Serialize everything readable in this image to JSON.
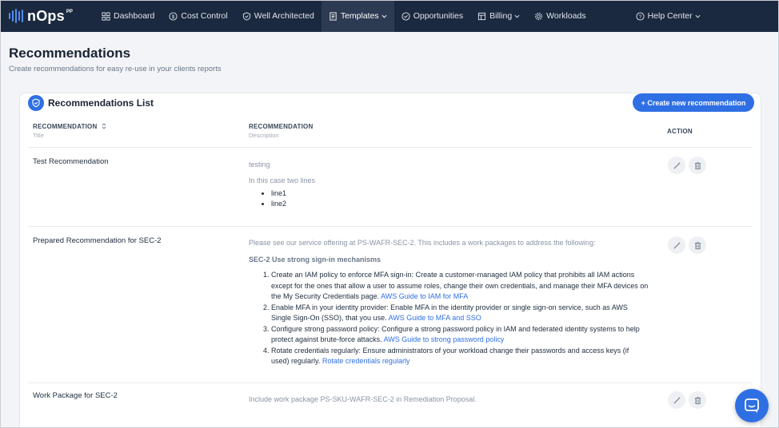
{
  "nav": {
    "logo_text": "nOps",
    "logo_sup": "PP",
    "items": [
      {
        "label": "Dashboard",
        "icon": "grid-icon"
      },
      {
        "label": "Cost Control",
        "icon": "dollar-circle-icon"
      },
      {
        "label": "Well Architected",
        "icon": "shield-check-icon"
      },
      {
        "label": "Templates",
        "icon": "document-icon",
        "active": true,
        "dropdown": true
      },
      {
        "label": "Opportunities",
        "icon": "check-circle-icon"
      },
      {
        "label": "Billing",
        "icon": "billing-icon",
        "dropdown": true
      },
      {
        "label": "Workloads",
        "icon": "gear-icon"
      }
    ],
    "help": {
      "label": "Help Center",
      "icon": "help-circle-icon"
    }
  },
  "page": {
    "title": "Recommendations",
    "subtitle": "Create recommendations for easy re-use in your clients reports"
  },
  "card": {
    "title": "Recommendations List",
    "create_button": "+ Create new recommendation"
  },
  "table": {
    "columns": [
      {
        "label": "RECOMMENDATION",
        "sub": "Title"
      },
      {
        "label": "RECOMMENDATION",
        "sub": "Description"
      },
      {
        "label": "ACTION",
        "sub": ""
      }
    ],
    "rows": [
      {
        "title": "Test Recommendation",
        "desc_line1": "testing",
        "desc_line2": "In this case two lines",
        "bullets": [
          "line1",
          "line2"
        ]
      },
      {
        "title": "Prepared Recommendation for SEC-2",
        "intro": "Please see our service offering at PS-WAFR-SEC-2. This includes a work packages to address the following:",
        "subhead": "SEC-2 Use strong sign-in mechanisms",
        "items": [
          {
            "text": "Create an IAM policy to enforce MFA sign-in: Create a customer-managed IAM policy that prohibits all IAM actions except for the ones that allow a user to assume roles, change their own credentials, and manage their MFA devices on the My Security Credentials page.",
            "link": "AWS Guide to IAM for MFA"
          },
          {
            "text": "Enable MFA in your identity provider: Enable MFA in the identity provider or single sign-on service, such as AWS Single Sign-On (SSO), that you use.",
            "link": "AWS Guide to MFA and SSO"
          },
          {
            "text": "Configure strong password policy: Configure a strong password policy in IAM and federated identity systems to help protect against brute-force attacks.",
            "link": "AWS Guide to strong password policy"
          },
          {
            "text": "Rotate credentials regularly: Ensure administrators of your workload change their passwords and access keys (if used) regularly.",
            "link": "Rotate credentials regularly"
          }
        ]
      },
      {
        "title": "Work Package for SEC-2",
        "desc_line1": "Include work package PS-SKU-WAFR-SEC-2 in Remediation Proposal."
      }
    ]
  },
  "colors": {
    "nav_bg": "#1b2940",
    "accent": "#2f6fe4",
    "link": "#2f6fe4"
  }
}
